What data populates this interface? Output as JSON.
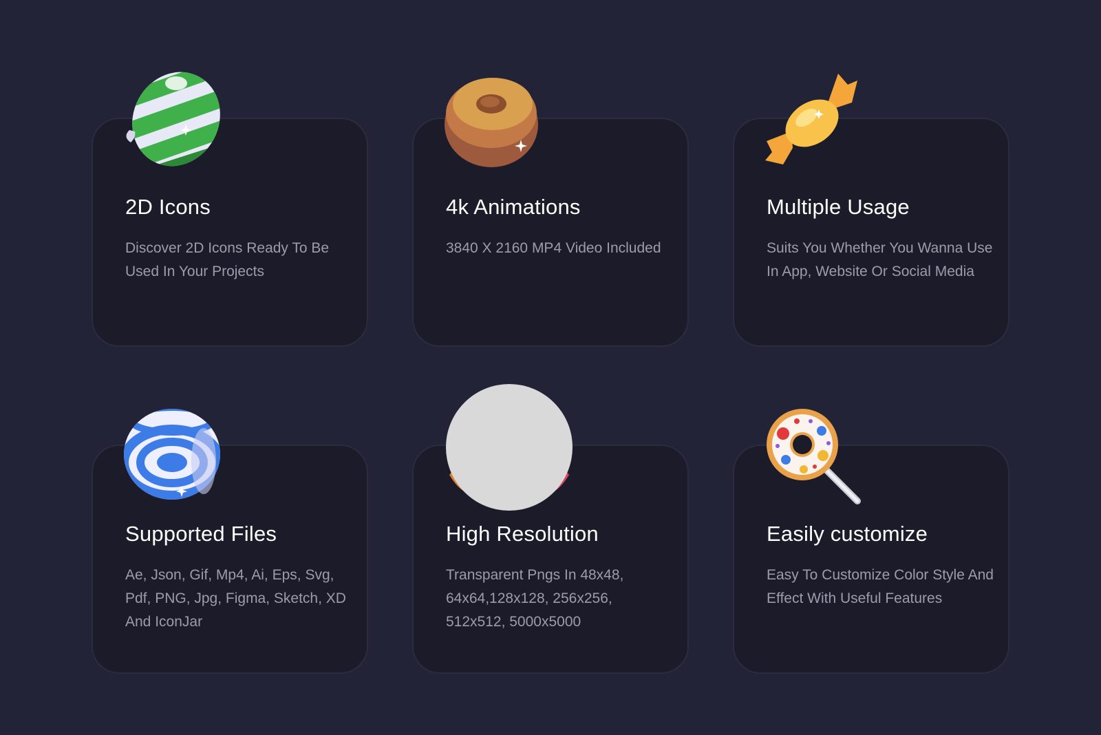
{
  "colors": {
    "background": "#222336",
    "card": "#1b1b2a",
    "card_border": "#2b2c3f",
    "title": "#ffffff",
    "description": "#9c9cab"
  },
  "features": [
    {
      "icon": "striped-candy-icon",
      "title": "2D Icons",
      "description": "Discover 2D Icons Ready To Be Used In Your Projects"
    },
    {
      "icon": "round-chocolate-icon",
      "title": "4k Animations",
      "description": "3840 X 2160 MP4 Video Included"
    },
    {
      "icon": "wrapped-candy-icon",
      "title": "Multiple Usage",
      "description": "Suits You Whether You Wanna Use In App, Website Or Social Media"
    },
    {
      "icon": "blue-striped-candy-icon",
      "title": "Supported Files",
      "description": "Ae, Json, Gif, Mp4, Ai, Eps, Svg, Pdf, PNG, Jpg, Figma, Sketch, XD And IconJar"
    },
    {
      "icon": "image-placeholder-icon",
      "title": "High Resolution",
      "description": "Transparent Pngs In 48x48, 64x64,128x128, 256x256, 512x512, 5000x5000"
    },
    {
      "icon": "donut-lollipop-icon",
      "title": "Easily customize",
      "description": "Easy To Customize Color Style And Effect With Useful Features"
    }
  ]
}
